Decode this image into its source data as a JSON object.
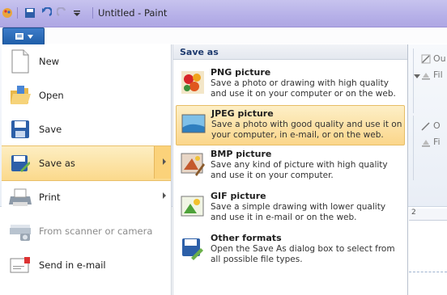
{
  "window": {
    "title": "Untitled - Paint"
  },
  "file_menu": {
    "left_items": [
      {
        "label": "New",
        "icon": "new-document-icon",
        "has_submenu": false,
        "enabled": true
      },
      {
        "label": "Open",
        "icon": "open-folder-icon",
        "has_submenu": false,
        "enabled": true
      },
      {
        "label": "Save",
        "icon": "save-disk-icon",
        "has_submenu": false,
        "enabled": true
      },
      {
        "label": "Save as",
        "icon": "save-as-icon",
        "has_submenu": true,
        "enabled": true,
        "highlighted": true
      },
      {
        "label": "Print",
        "icon": "printer-icon",
        "has_submenu": true,
        "enabled": true
      },
      {
        "label": "From scanner or camera",
        "icon": "scanner-icon",
        "has_submenu": false,
        "enabled": false
      },
      {
        "label": "Send in e-mail",
        "icon": "email-icon",
        "has_submenu": false,
        "enabled": true
      }
    ],
    "saveas_panel": {
      "header": "Save as",
      "options": [
        {
          "title": "PNG picture",
          "description": "Save a photo or drawing with high quality and use it on your computer or on the web.",
          "icon": "png-picture-icon",
          "highlighted": false
        },
        {
          "title": "JPEG picture",
          "description": "Save a photo with good quality and use it on your computer, in e-mail, or on the web.",
          "icon": "jpeg-picture-icon",
          "highlighted": true
        },
        {
          "title": "BMP picture",
          "description": "Save any kind of picture with high quality and use it on your computer.",
          "icon": "bmp-picture-icon",
          "highlighted": false
        },
        {
          "title": "GIF picture",
          "description": "Save a simple drawing with lower quality and use it in e-mail or on the web.",
          "icon": "gif-picture-icon",
          "highlighted": false
        },
        {
          "title": "Other formats",
          "description": "Open the Save As dialog box to select from all possible file types.",
          "icon": "other-formats-icon",
          "highlighted": false
        }
      ]
    }
  },
  "ribbon": {
    "outline_label": "Ou",
    "fill_label": "Fil",
    "fill_label_2": "Fi"
  },
  "colors": {
    "highlight_top": "#fdeec2",
    "highlight_bottom": "#fbd98c",
    "title_bar": "#b6b0e8",
    "menu_button": "#2a6bbb"
  }
}
